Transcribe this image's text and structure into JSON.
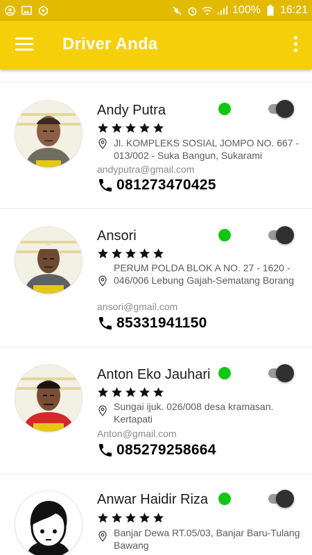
{
  "status_bar": {
    "battery": "100%",
    "time": "16:21"
  },
  "app_bar": {
    "title": "Driver Anda",
    "menu_icon": "hamburger-menu-icon",
    "overflow_icon": "more-vert-icon"
  },
  "colors": {
    "app_bar": "#f5cf09",
    "status_bar": "#e2bb00",
    "online_dot": "#11c611"
  },
  "drivers": [
    {
      "name": "Andy Putra",
      "rating": 5,
      "address": "Jl. KOMPLEKS SOSIAL JOMPO NO. 667 - 013/002 - Suka Bangun, Sukarami",
      "email": "andyputra@gmail.com",
      "phone": "081273470425",
      "online": true,
      "toggle_on": true
    },
    {
      "name": "Ansori",
      "rating": 5,
      "address": "PERUM POLDA BLOK A NO. 27 - 1620 - 046/006 Lebung Gajah-Sematang Borang",
      "email": "ansori@gmail.com",
      "phone": "85331941150",
      "online": true,
      "toggle_on": true
    },
    {
      "name": "Anton Eko Jauhari",
      "rating": 5,
      "address": "Sungai ijuk. 026/008 desa kramasan. Kertapati",
      "email": "Anton@gmail.com",
      "phone": "085279258664",
      "online": true,
      "toggle_on": true
    },
    {
      "name": "Anwar Haidir Riza",
      "rating": 5,
      "address": "Banjar Dewa RT.05/03, Banjar Baru-Tulang Bawang",
      "online": true,
      "toggle_on": true
    }
  ]
}
